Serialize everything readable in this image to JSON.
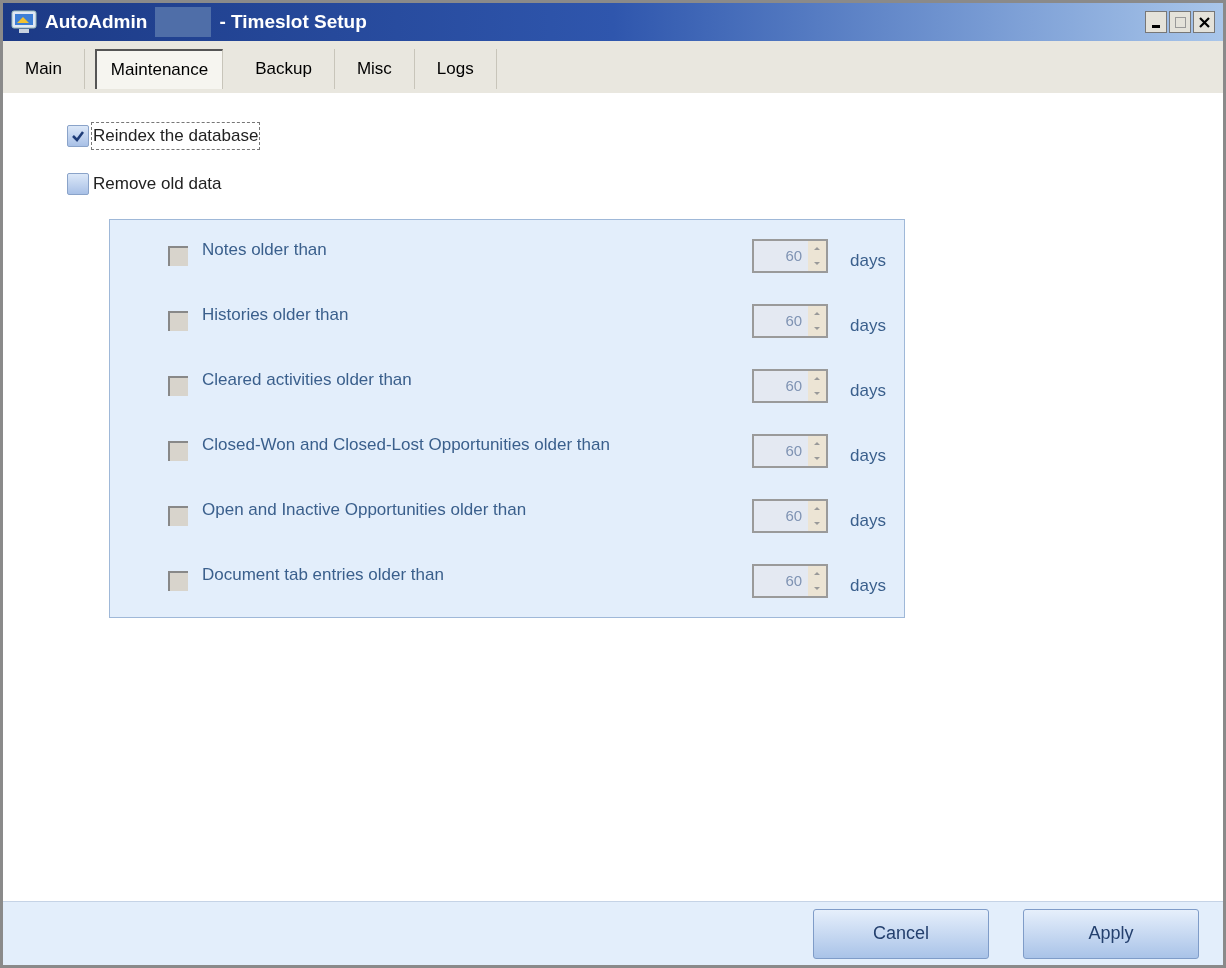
{
  "window": {
    "title_app": "AutoAdmin",
    "title_rest": "- Timeslot Setup"
  },
  "tabs": [
    {
      "label": "Main",
      "selected": false
    },
    {
      "label": "Maintenance",
      "selected": true
    },
    {
      "label": "Backup",
      "selected": false
    },
    {
      "label": "Misc",
      "selected": false
    },
    {
      "label": "Logs",
      "selected": false
    }
  ],
  "options": [
    {
      "label": "Reindex the database",
      "checked": true,
      "focused": true
    },
    {
      "label": "Remove old data",
      "checked": false,
      "focused": false
    }
  ],
  "remove_items": [
    {
      "label": "Notes older than",
      "checked": false,
      "disabled": true,
      "value": "60",
      "unit": "days"
    },
    {
      "label": "Histories older than",
      "checked": false,
      "disabled": true,
      "value": "60",
      "unit": "days"
    },
    {
      "label": "Cleared activities older than",
      "checked": false,
      "disabled": true,
      "value": "60",
      "unit": "days"
    },
    {
      "label": "Closed-Won and Closed-Lost Opportunities older than",
      "checked": false,
      "disabled": true,
      "value": "60",
      "unit": "days"
    },
    {
      "label": "Open and Inactive Opportunities older than",
      "checked": false,
      "disabled": true,
      "value": "60",
      "unit": "days"
    },
    {
      "label": "Document tab entries older than",
      "checked": false,
      "disabled": true,
      "value": "60",
      "unit": "days"
    }
  ],
  "buttons": [
    "Cancel",
    "Apply"
  ]
}
